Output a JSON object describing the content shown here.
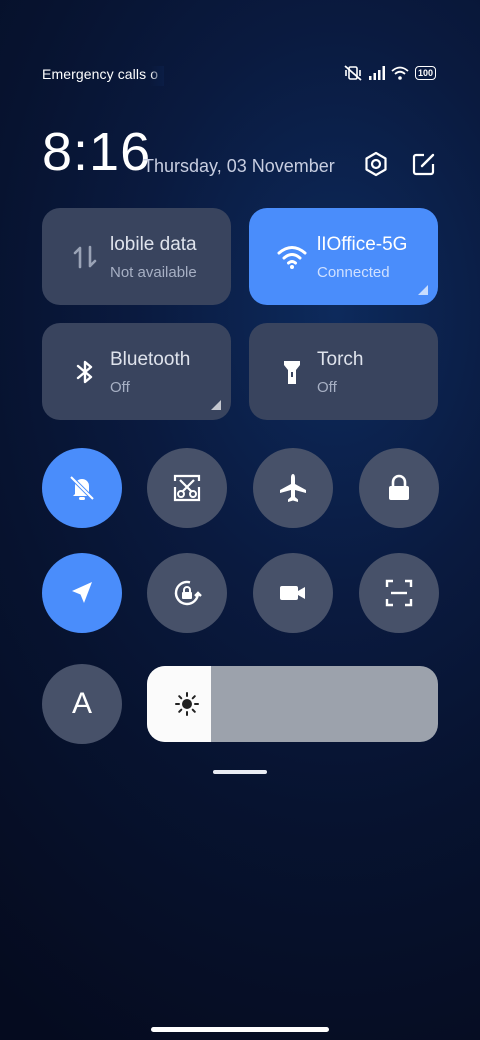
{
  "status_bar": {
    "carrier": "Emergency calls o",
    "battery": "100",
    "icons": [
      "mute-vibrate-icon",
      "signal-icon",
      "wifi-icon",
      "battery-icon"
    ]
  },
  "header": {
    "time": "8:16",
    "date": "Thursday, 03 November",
    "icons": [
      "settings-icon",
      "edit-icon"
    ]
  },
  "tiles": [
    {
      "id": "mobile-data",
      "title": "lobile data",
      "subtitle": "Not available",
      "active": false,
      "icon": "mobile-data-icon"
    },
    {
      "id": "wifi",
      "title": "lIOffice-5G",
      "subtitle": "Connected",
      "active": true,
      "icon": "wifi-icon"
    },
    {
      "id": "bluetooth",
      "title": "Bluetooth",
      "subtitle": "Off",
      "active": false,
      "icon": "bluetooth-icon"
    },
    {
      "id": "torch",
      "title": "Torch",
      "subtitle": "Off",
      "active": false,
      "icon": "torch-icon"
    }
  ],
  "toggles": [
    {
      "id": "silent",
      "active": true,
      "icon": "bell-off-icon"
    },
    {
      "id": "screenshot",
      "active": false,
      "icon": "scissors-icon"
    },
    {
      "id": "airplane",
      "active": false,
      "icon": "airplane-icon"
    },
    {
      "id": "lock",
      "active": false,
      "icon": "lock-icon"
    },
    {
      "id": "location",
      "active": true,
      "icon": "location-arrow-icon"
    },
    {
      "id": "auto-rotate",
      "active": false,
      "icon": "rotation-lock-icon"
    },
    {
      "id": "screen-recorder",
      "active": false,
      "icon": "video-camera-icon"
    },
    {
      "id": "scanner",
      "active": false,
      "icon": "scan-icon"
    }
  ],
  "auto_brightness": {
    "label": "A"
  },
  "brightness": {
    "level_percent": 22
  },
  "colors": {
    "accent": "#4a8dfb",
    "tile": "#39445e",
    "circle": "#475169"
  }
}
